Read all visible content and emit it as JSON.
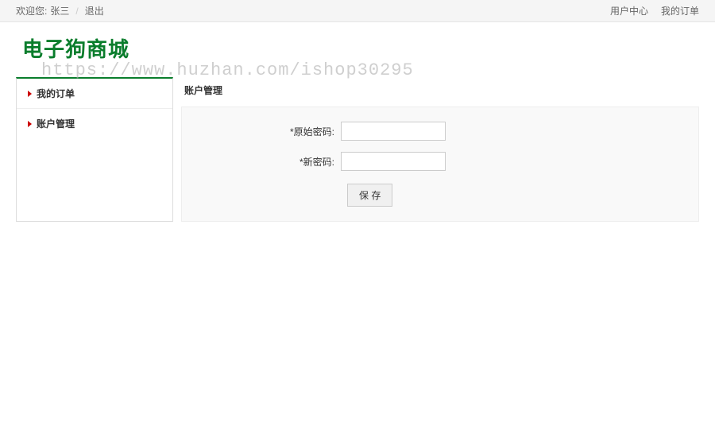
{
  "topbar": {
    "greeting": "欢迎您:",
    "username": "张三",
    "separator": "/",
    "logout": "退出",
    "user_center": "用户中心",
    "my_orders": "我的订单"
  },
  "header": {
    "logo": "电子狗商城",
    "watermark": "https://www.huzhan.com/ishop30295"
  },
  "sidebar": {
    "items": [
      {
        "label": "我的订单"
      },
      {
        "label": "账户管理"
      }
    ]
  },
  "main": {
    "title": "账户管理",
    "form": {
      "old_password_label": "*原始密码:",
      "new_password_label": "*新密码:",
      "save_label": "保 存"
    }
  }
}
